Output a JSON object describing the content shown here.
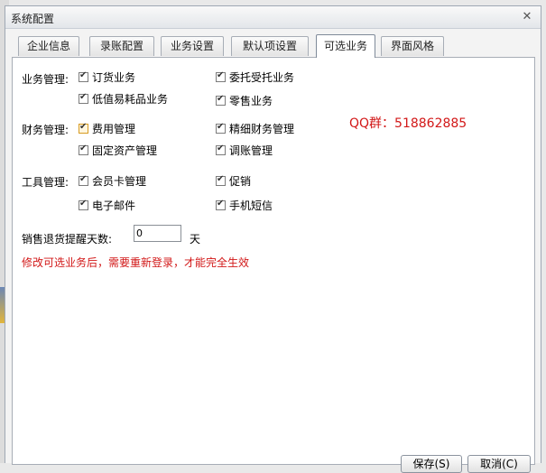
{
  "window": {
    "title": "系统配置",
    "close_glyph": "✕"
  },
  "tabs": [
    {
      "label": "企业信息"
    },
    {
      "label": "录账配置"
    },
    {
      "label": "业务设置"
    },
    {
      "label": "默认项设置"
    },
    {
      "label": "可选业务",
      "active": true
    },
    {
      "label": "界面风格"
    }
  ],
  "groups": {
    "business": {
      "label": "业务管理:",
      "items": [
        {
          "label": "订货业务",
          "checked": true
        },
        {
          "label": "委托受托业务",
          "checked": true
        },
        {
          "label": "低值易耗品业务",
          "checked": true
        },
        {
          "label": "零售业务",
          "checked": true
        }
      ]
    },
    "finance": {
      "label": "财务管理:",
      "items": [
        {
          "label": "费用管理",
          "checked": true
        },
        {
          "label": "精细财务管理",
          "checked": true
        },
        {
          "label": "固定资产管理",
          "checked": true
        },
        {
          "label": "调账管理",
          "checked": true
        }
      ]
    },
    "tools": {
      "label": "工具管理:",
      "items": [
        {
          "label": "会员卡管理",
          "checked": true
        },
        {
          "label": "促销",
          "checked": true
        },
        {
          "label": "电子邮件",
          "checked": true
        },
        {
          "label": "手机短信",
          "checked": true
        }
      ]
    }
  },
  "qq_text": "QQ群：518862885",
  "return_days": {
    "label": "销售退货提醒天数:",
    "value": "0",
    "unit": "天"
  },
  "warning": "修改可选业务后，需要重新登录，才能完全生效",
  "buttons": {
    "save": "保存(S)",
    "cancel": "取消(C)"
  },
  "colors": {
    "warning": "#d21818",
    "highlight_checkbox": "#d79b22"
  }
}
